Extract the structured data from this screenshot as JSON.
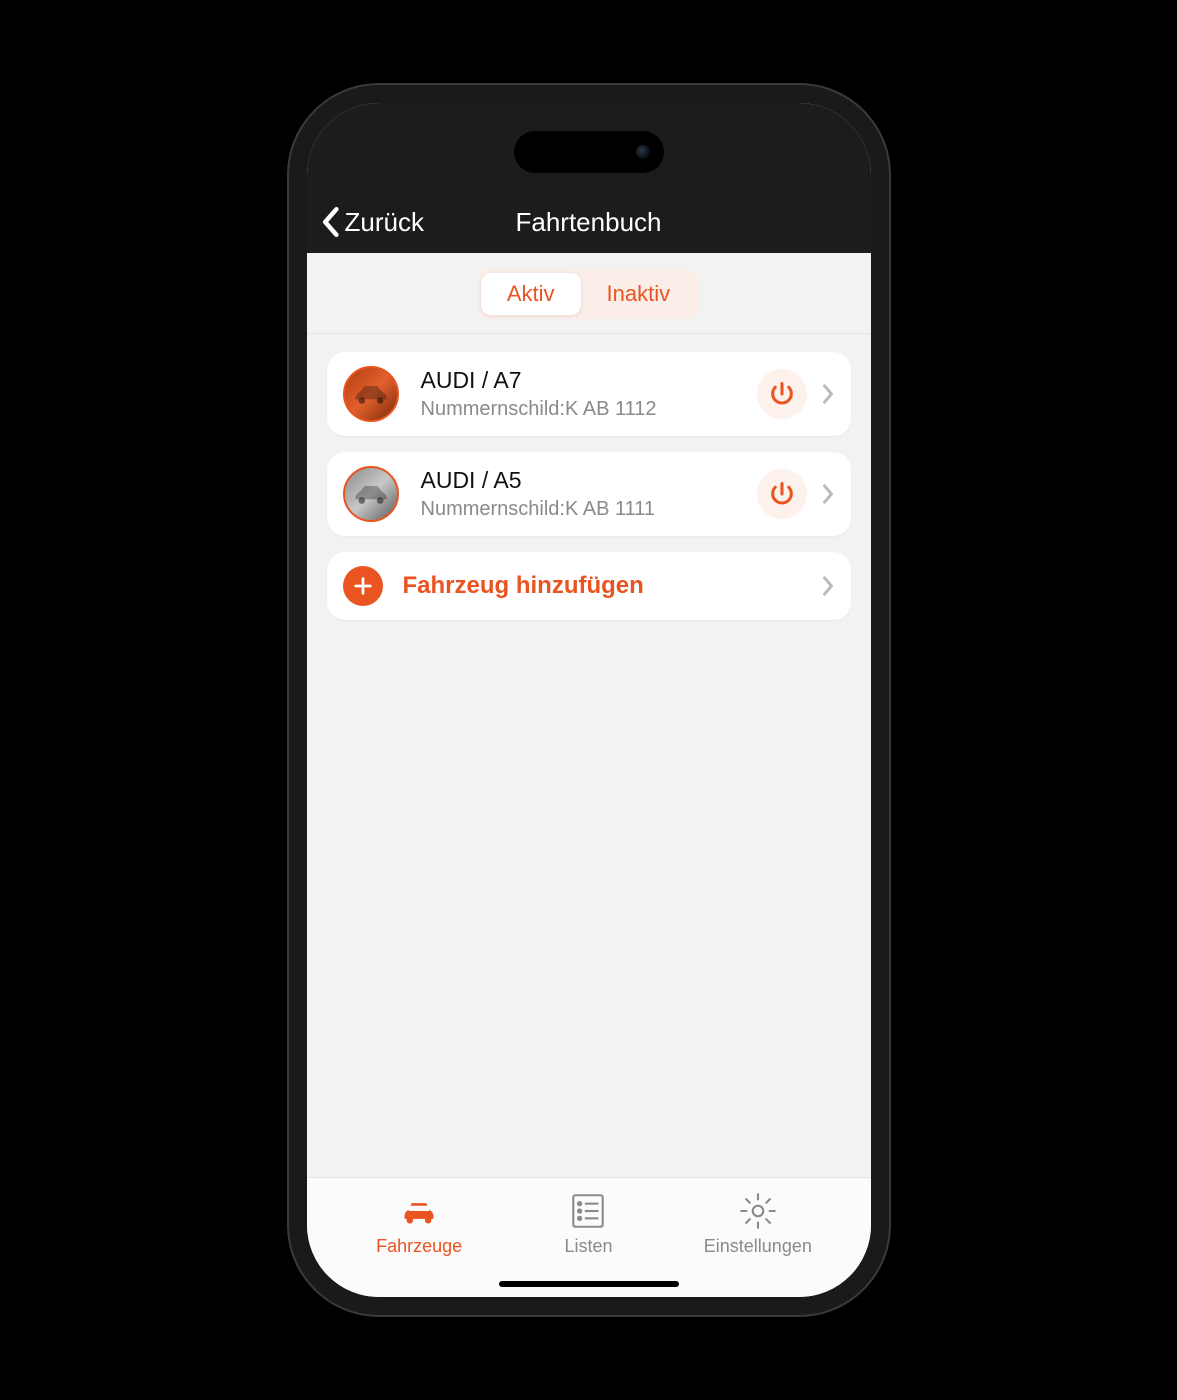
{
  "nav": {
    "back_label": "Zurück",
    "title": "Fahrtenbuch"
  },
  "segmented": {
    "active_label": "Aktiv",
    "inactive_label": "Inaktiv",
    "selected": "Aktiv"
  },
  "vehicles": [
    {
      "title": "AUDI / A7",
      "plate_label": "Nummernschild:",
      "plate_value": "K AB 1112",
      "avatar_style": "orange"
    },
    {
      "title": "AUDI / A5",
      "plate_label": "Nummernschild:",
      "plate_value": "K AB 1111",
      "avatar_style": "grey"
    }
  ],
  "add_vehicle_label": "Fahrzeug hinzufügen",
  "tabs": {
    "vehicles": "Fahrzeuge",
    "lists": "Listen",
    "settings": "Einstellungen",
    "active": "vehicles"
  },
  "colors": {
    "accent": "#e95420"
  }
}
